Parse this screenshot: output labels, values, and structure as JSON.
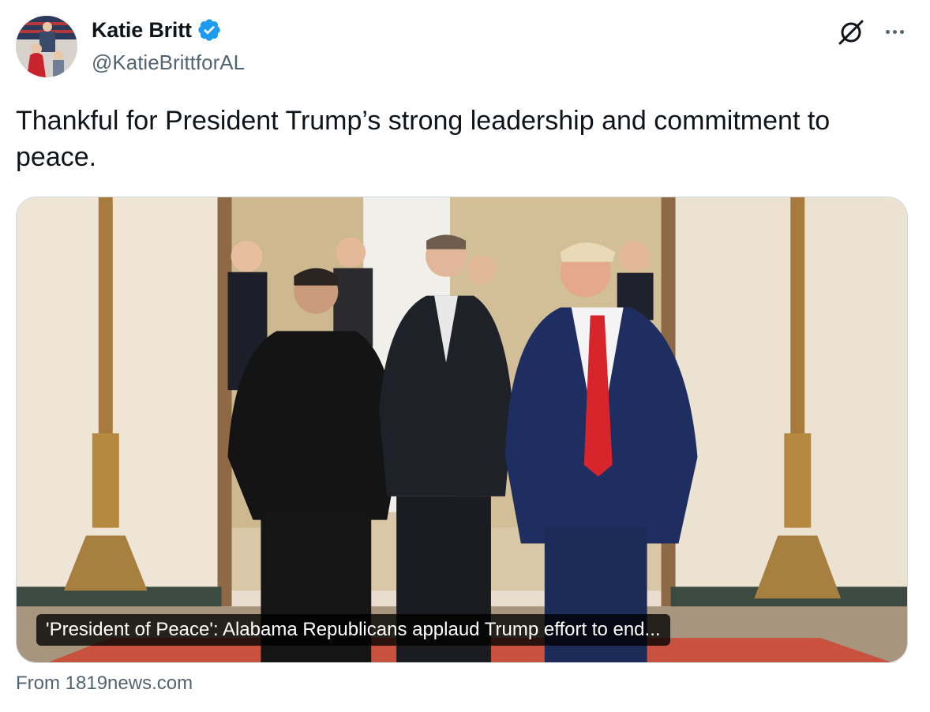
{
  "author": {
    "display_name": "Katie Britt",
    "handle": "@KatieBrittforAL",
    "verified_icon": "verified-badge-icon",
    "avatar": "avatar"
  },
  "actions": {
    "grok_icon": "grok-slash-icon",
    "more_icon": "more-horizontal-icon"
  },
  "tweet": {
    "text": "Thankful for President Trump’s strong leadership and commitment to peace."
  },
  "media": {
    "caption": "'President of Peace': Alabama Republicans applaud Trump effort to end...",
    "source": "From 1819news.com"
  },
  "colors": {
    "verified": "#1d9bf0",
    "secondary_text": "#536471",
    "primary_text": "#0f1419"
  }
}
